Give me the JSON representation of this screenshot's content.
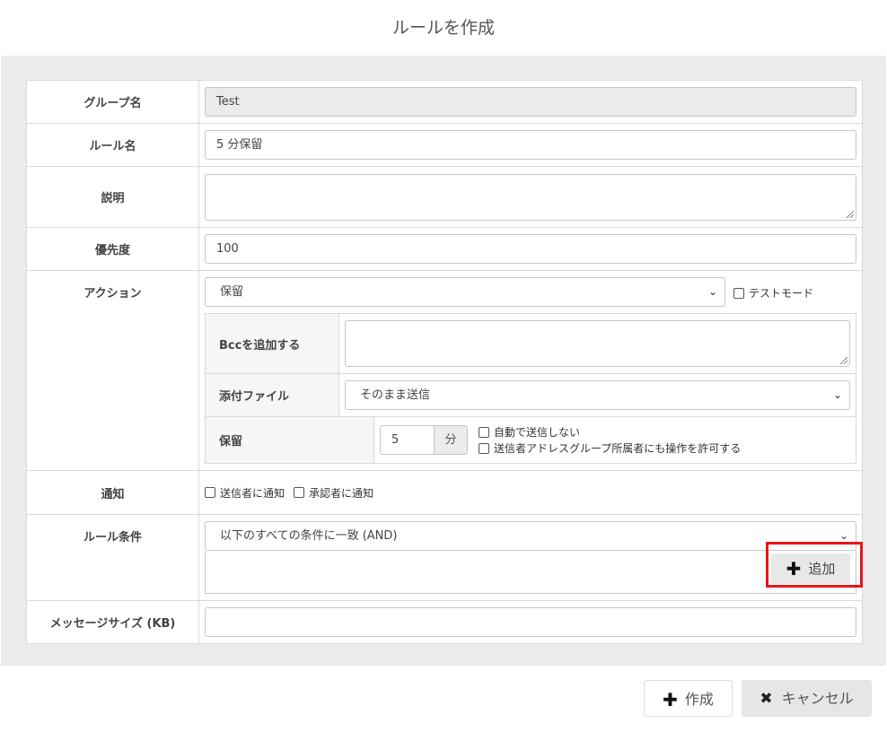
{
  "dialog": {
    "title": "ルールを作成"
  },
  "form": {
    "group_name": {
      "label": "グループ名",
      "value": "Test"
    },
    "rule_name": {
      "label": "ルール名",
      "value": "5 分保留"
    },
    "description": {
      "label": "説明",
      "value": ""
    },
    "priority": {
      "label": "優先度",
      "value": "100"
    },
    "action": {
      "label": "アクション",
      "selected": "保留",
      "test_mode_label": "テストモード",
      "bcc": {
        "label": "Bccを追加する",
        "value": ""
      },
      "attachment": {
        "label": "添付ファイル",
        "selected": "そのまま送信"
      },
      "hold": {
        "label": "保留",
        "value": "5",
        "unit": "分",
        "no_auto_send_label": "自動で送信しない",
        "allow_group_label": "送信者アドレスグループ所属者にも操作を許可する"
      }
    },
    "notify": {
      "label": "通知",
      "sender_label": "送信者に通知",
      "approver_label": "承認者に通知"
    },
    "conditions": {
      "label": "ルール条件",
      "selected": "以下のすべての条件に一致 (AND)",
      "add_label": "追加"
    },
    "message_size": {
      "label": "メッセージサイズ (KB)",
      "value": ""
    }
  },
  "footer": {
    "create_label": "作成",
    "cancel_label": "キャンセル"
  },
  "colors": {
    "highlight": "#e8141b",
    "panel_bg": "#ebebeb"
  },
  "icons": {
    "add": "plus-icon",
    "cancel": "x-icon",
    "dropdown": "chevron-down-icon"
  }
}
